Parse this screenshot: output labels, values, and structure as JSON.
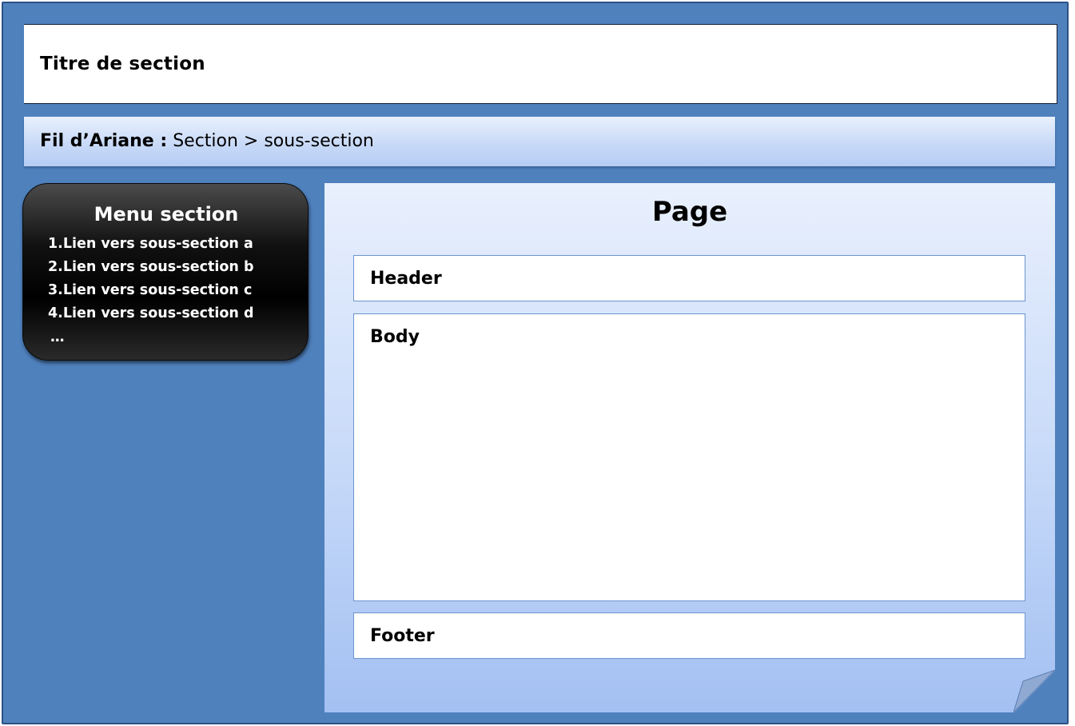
{
  "title": "Titre de section",
  "breadcrumb": {
    "label": "Fil d’Ariane :",
    "path": "Section > sous-section"
  },
  "menu": {
    "title": "Menu section",
    "items": [
      "1.Lien vers sous-section a",
      "2.Lien vers sous-section b",
      "3.Lien vers sous-section c",
      "4.Lien vers sous-section d",
      "…"
    ]
  },
  "page": {
    "title": "Page",
    "header_label": "Header",
    "body_label": "Body",
    "footer_label": "Footer"
  },
  "colors": {
    "background": "#4f81bd",
    "menu_background": "#000000",
    "panel_light": "#e9f0fd",
    "panel_dark": "#a3c0f2"
  }
}
